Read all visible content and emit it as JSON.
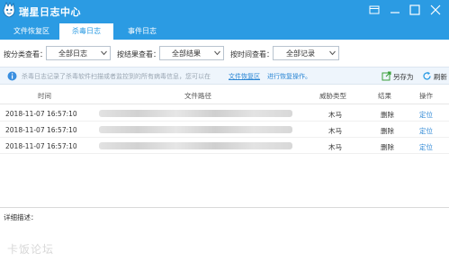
{
  "app": {
    "title": "瑞星日志中心"
  },
  "tabs": [
    {
      "label": "文件恢复区",
      "active": false
    },
    {
      "label": "杀毒日志",
      "active": true
    },
    {
      "label": "事件日志",
      "active": false
    }
  ],
  "filters": [
    {
      "label": "按分类查看：",
      "value": "全部日志"
    },
    {
      "label": "按结果查看：",
      "value": "全部结果"
    },
    {
      "label": "按时间查看：",
      "value": "全部记录"
    }
  ],
  "info": {
    "text": "杀毒日志记录了杀毒软件扫描或者监控到的所有病毒信息，您可以在",
    "link": "文件恢复区",
    "link_suffix": "进行恢复操作。",
    "export_label": "另存为",
    "refresh_label": "刷新"
  },
  "table": {
    "columns": [
      "时间",
      "文件路径",
      "威胁类型",
      "结果",
      "操作"
    ],
    "rows": [
      {
        "time": "2018-11-07 16:57:10",
        "threat": "木马",
        "result": "删除",
        "action": "定位"
      },
      {
        "time": "2018-11-07 16:57:10",
        "threat": "木马",
        "result": "删除",
        "action": "定位"
      },
      {
        "time": "2018-11-07 16:57:10",
        "threat": "木马",
        "result": "删除",
        "action": "定位"
      }
    ]
  },
  "detail": {
    "label": "详细描述："
  },
  "watermark": "卡饭论坛",
  "colors": {
    "accent": "#2b9be3",
    "link": "#2b86d4",
    "info_bg": "#eef5fc"
  }
}
